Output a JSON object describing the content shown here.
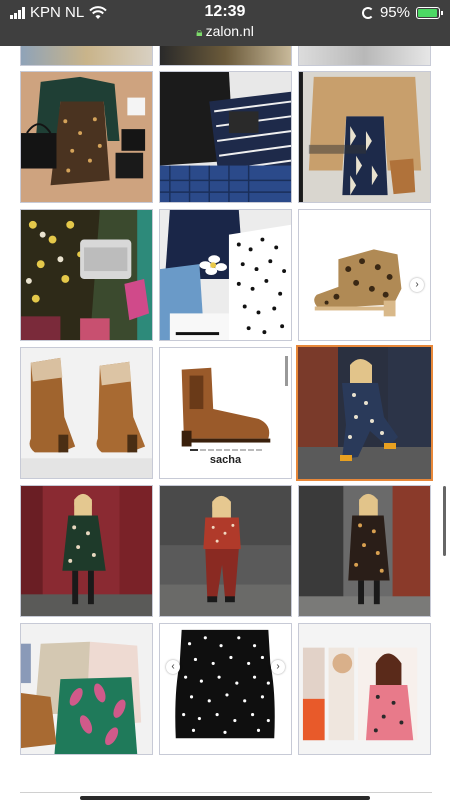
{
  "status_bar": {
    "carrier": "KPN NL",
    "time": "12:39",
    "url": "zalon.nl",
    "battery_percent": "95%",
    "battery_level": 0.95,
    "colors": {
      "background": "#3f3f3f",
      "battery": "#4cd964",
      "lock": "#7ddc6b"
    },
    "icons": [
      "signal-bars-icon",
      "wifi-icon",
      "lock-icon",
      "rotation-lock-icon",
      "battery-icon"
    ]
  },
  "gallery": {
    "product_caption": "sacha",
    "carousel_arrows": {
      "left": "‹",
      "right": "›"
    },
    "highlight_color": "#e8883a"
  }
}
